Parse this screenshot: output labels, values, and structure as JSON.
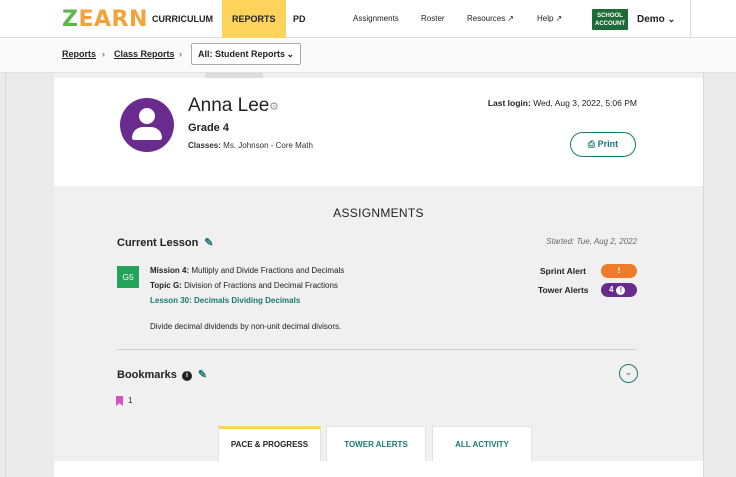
{
  "nav": {
    "logo": "ZEARN",
    "items": [
      "CURRICULUM",
      "REPORTS",
      "PD"
    ],
    "assignments": "Assignments",
    "roster": "Roster",
    "resources": "Resources",
    "help": "Help",
    "school_account_1": "SCHOOL",
    "school_account_2": "ACCOUNT",
    "user": "Demo"
  },
  "breadcrumb": {
    "reports": "Reports",
    "class_reports": "Class Reports",
    "selected": "All: Student Reports"
  },
  "student": {
    "name": "Anna Lee",
    "grade": "Grade 4",
    "classes_label": "Classes:",
    "classes_value": "Ms. Johnson - Core Math",
    "last_login_label": "Last login:",
    "last_login_value": "Wed, Aug 3, 2022, 5:06 PM",
    "print": "Print"
  },
  "assignments": {
    "title": "ASSIGNMENTS",
    "current_lesson": "Current Lesson",
    "started": "Started: Tue, Aug 2, 2022",
    "grade_badge": "G5",
    "mission_label": "Mission 4:",
    "mission_value": "Multiply and Divide Fractions and Decimals",
    "topic_label": "Topic G:",
    "topic_value": "Division of Fractions and Decimal Fractions",
    "lesson": "Lesson 30: Decimals Dividing Decimals",
    "description": "Divide decimal dividends by non-unit decimal divisors.",
    "sprint_alert": "Sprint Alert",
    "sprint_value": "!",
    "tower_alerts": "Tower Alerts",
    "tower_count": "4",
    "bookmarks": "Bookmarks",
    "bookmark_count": "1"
  },
  "tabs": [
    "PACE & PROGRESS",
    "TOWER ALERTS",
    "ALL ACTIVITY"
  ],
  "colors": {
    "accent_yellow": "#fed35c",
    "teal": "#1a7a72",
    "purple": "#6a2b8f",
    "orange": "#ef7a2a",
    "green": "#26a35a"
  }
}
